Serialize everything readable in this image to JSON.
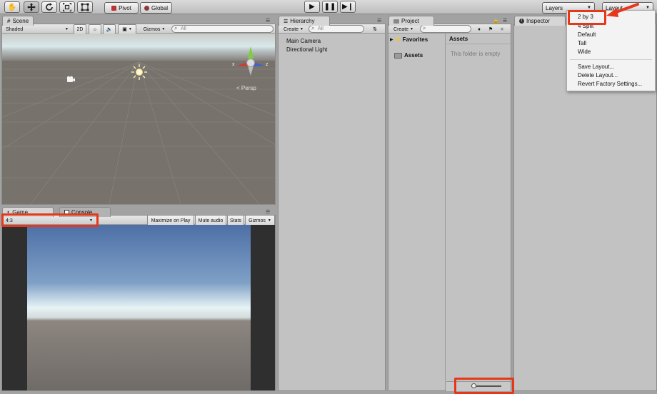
{
  "toolbar": {
    "tools": [
      "hand-tool",
      "move-tool",
      "rotate-tool",
      "scale-tool",
      "rect-tool"
    ],
    "pivot_label": "Pivot",
    "global_label": "Global",
    "layers_label": "Layers",
    "layout_label": "Layout"
  },
  "scene": {
    "tab_label": "Scene",
    "shading_mode": "Shaded",
    "mode_2d": "2D",
    "gizmos_label": "Gizmos",
    "search_placeholder": "All",
    "gizmo_x": "x",
    "gizmo_z": "z",
    "persp_label": "Persp"
  },
  "game": {
    "tab_label": "Game",
    "console_tab_label": "Console",
    "aspect": "4:3",
    "maximize_label": "Maximize on Play",
    "mute_label": "Mute audio",
    "stats_label": "Stats",
    "gizmos_label": "Gizmos"
  },
  "hierarchy": {
    "tab_label": "Hierarchy",
    "create_label": "Create",
    "search_placeholder": "All",
    "items": [
      "Main Camera",
      "Directional Light"
    ]
  },
  "project": {
    "tab_label": "Project",
    "create_label": "Create",
    "favorites_label": "Favorites",
    "assets_folder_label": "Assets",
    "assets_header": "Assets",
    "empty_message": "This folder is empty"
  },
  "inspector": {
    "tab_label": "Inspector"
  },
  "layout_menu": {
    "items": [
      "2 by 3",
      "4 Split",
      "Default",
      "Tall",
      "Wide"
    ],
    "actions": [
      "Save Layout...",
      "Delete Layout...",
      "Revert Factory Settings..."
    ]
  },
  "colors": {
    "highlight": "#e6371a",
    "sky_top": "#4d6fa6",
    "ground": "#6f6b66"
  }
}
